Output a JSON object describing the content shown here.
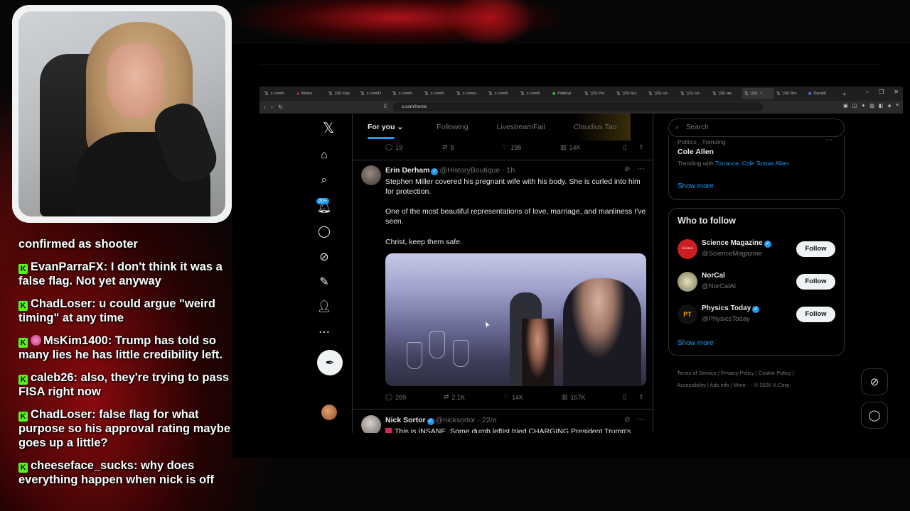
{
  "chat": [
    {
      "user": "",
      "text": "confirmed as shooter"
    },
    {
      "user": "EvanParraFX",
      "text": "I don't think it was a false flag. Not yet anyway"
    },
    {
      "user": "ChadLoser",
      "text": "u could argue \"weird timing\" at any time"
    },
    {
      "user": "MsKim1400",
      "text": "Trump has told so many lies he has little credibility left."
    },
    {
      "user": "caleb26",
      "text": "also, they're trying to pass FISA right now"
    },
    {
      "user": "ChadLoser",
      "text": "false flag for what purpose so his approval rating maybe goes up a little?"
    },
    {
      "user": "cheeseface_sucks",
      "text": "why does everything happen when nick is off"
    }
  ],
  "browser": {
    "tabs": [
      "x.com/h",
      "Moms",
      "(16) Kap",
      "x.com/D",
      "x.com/h",
      "x.com/h",
      "x.com/a",
      "x.com/h",
      "x.com/h",
      "Political",
      "(21) Pet",
      "(20) Rui",
      "(20) Ho",
      "(21) Ho",
      "(16) ale",
      "(20)",
      "(16) Bre",
      "Donald"
    ],
    "url": "x.com/home"
  },
  "x": {
    "notif_count": "20+",
    "timeline_tabs": [
      "For you",
      "Following",
      "LivestreamFail",
      "Claudius Tao"
    ],
    "prev_actions": {
      "replies": "19",
      "reposts": "8",
      "likes": "198",
      "views": "14K"
    },
    "tweet1": {
      "name": "Erin Derham",
      "handle": "@HistoryBoutique",
      "time": "· 1h",
      "text1": "Stephen Miller covered his pregnant wife with his body. She is curled into him for protection.",
      "text2": "One of the most beautiful representations of love, marriage, and manliness I've seen.",
      "text3": "Christ, keep them safe.",
      "replies": "269",
      "reposts": "2.1K",
      "likes": "14K",
      "views": "167K"
    },
    "tweet2": {
      "name": "Nick Sortor",
      "handle": "@nicksortor",
      "time": "· 22m",
      "text": "This is INSANE. Some dumb leftist tried CHARGING President Trump's"
    },
    "search_placeholder": "Search",
    "trending": {
      "category": "Politics · Trending",
      "topic": "Cole Allen",
      "with_label": "Trending with",
      "with_links": [
        "Torrance",
        "Cole Tomas Allen"
      ],
      "show_more": "Show more"
    },
    "who_to_follow": {
      "title": "Who to follow",
      "items": [
        {
          "name": "Science Magazine",
          "handle": "@ScienceMagazine",
          "avatar_text": "Science",
          "color": "#cc1f24"
        },
        {
          "name": "NorCal",
          "handle": "@NorCalAI",
          "avatar_text": "",
          "color": "#d8d4a8"
        },
        {
          "name": "Physics Today",
          "handle": "@PhysicsToday",
          "avatar_text": "PT",
          "color": "#111111"
        }
      ],
      "follow_label": "Follow",
      "show_more": "Show more"
    },
    "footer": {
      "line1": [
        "Terms of Service",
        "Privacy Policy",
        "Cookie Policy"
      ],
      "line2": [
        "Accessibility",
        "Ads info",
        "More ···",
        "© 2026 X Corp."
      ]
    }
  },
  "colors": {
    "accent": "#1d9bf0",
    "kick_green": "#53fc18",
    "border": "#2f3336",
    "muted": "#71767b"
  }
}
